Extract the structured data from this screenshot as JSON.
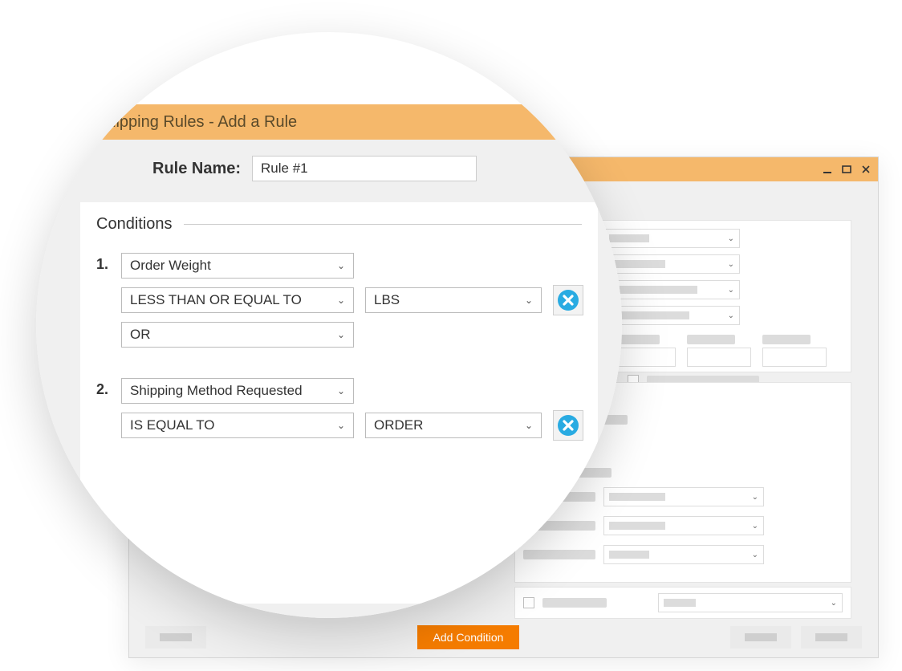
{
  "window_title": "Shipping Rules - Add a Rule",
  "rule_name_label": "Rule Name:",
  "rule_name_value": "Rule #1",
  "conditions_legend": "Conditions",
  "condition1": {
    "index": "1.",
    "field": "Order Weight",
    "operator": "LESS THAN OR EQUAL TO",
    "unit": "LBS",
    "join": "OR"
  },
  "condition2": {
    "index": "2.",
    "field": "Shipping Method Requested",
    "operator": "IS EQUAL TO",
    "unit": "ORDER"
  },
  "add_condition_label": "Add Condition"
}
